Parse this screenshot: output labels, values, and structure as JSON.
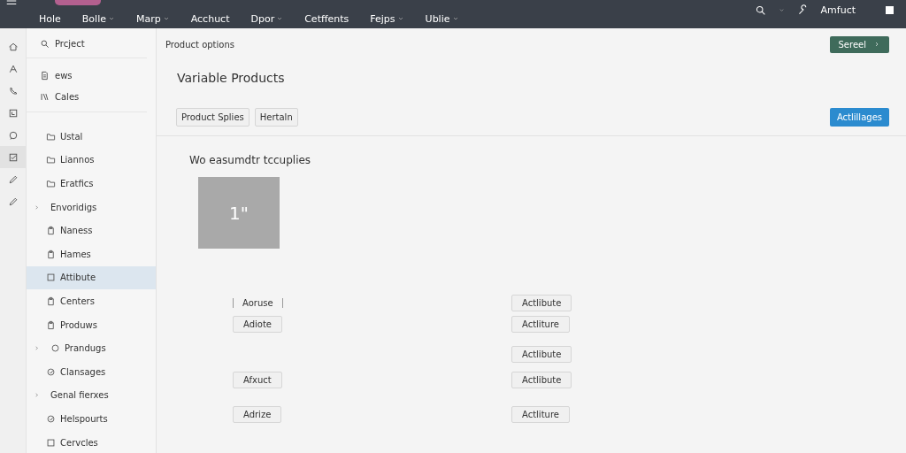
{
  "topbar": {
    "nav": [
      {
        "label": "Hole",
        "dropdown": false
      },
      {
        "label": "Bolle",
        "dropdown": true
      },
      {
        "label": "Marp",
        "dropdown": true
      },
      {
        "label": "Acchuct",
        "dropdown": false
      },
      {
        "label": "Dpor",
        "dropdown": true
      },
      {
        "label": "Cetffents",
        "dropdown": false
      },
      {
        "label": "Fejps",
        "dropdown": true
      },
      {
        "label": "Ublie",
        "dropdown": true
      }
    ],
    "account": "Amfuct"
  },
  "rail": [
    {
      "selected": false
    },
    {
      "selected": false
    },
    {
      "selected": false
    },
    {
      "selected": false
    },
    {
      "selected": false
    },
    {
      "selected": true
    },
    {
      "selected": false
    },
    {
      "selected": false
    }
  ],
  "sidebar": {
    "search": {
      "placeholder": "Prcject"
    },
    "top_items": [
      {
        "label": "ews"
      },
      {
        "label": "Cales"
      }
    ],
    "items": [
      {
        "label": "Ustal",
        "kind": "folder",
        "expander": false,
        "selected": false
      },
      {
        "label": "Liannos",
        "kind": "folder",
        "expander": false,
        "selected": false
      },
      {
        "label": "Eratfics",
        "kind": "folder",
        "expander": false,
        "selected": false
      },
      {
        "label": "Envoridigs",
        "kind": "group",
        "expander": true,
        "selected": false
      },
      {
        "label": "Naness",
        "kind": "page",
        "expander": false,
        "selected": false
      },
      {
        "label": "Hames",
        "kind": "page",
        "expander": false,
        "selected": false
      },
      {
        "label": "Attibute",
        "kind": "box",
        "expander": false,
        "selected": true
      },
      {
        "label": "Centers",
        "kind": "page",
        "expander": false,
        "selected": false
      },
      {
        "label": "Produws",
        "kind": "page",
        "expander": false,
        "selected": false
      },
      {
        "label": "Prandugs",
        "kind": "option",
        "expander": true,
        "selected": false
      },
      {
        "label": "Clansages",
        "kind": "task",
        "expander": false,
        "selected": false
      },
      {
        "label": "Genal fierxes",
        "kind": "group",
        "expander": true,
        "selected": false
      },
      {
        "label": "Helspourts",
        "kind": "task",
        "expander": false,
        "selected": false
      },
      {
        "label": "Cervcles",
        "kind": "box",
        "expander": false,
        "selected": false
      }
    ]
  },
  "main": {
    "breadcrumb": "Product options",
    "primary_button": "Sereel",
    "title": "Variable Products",
    "tabs": [
      {
        "label": "Product Splies"
      },
      {
        "label": "Hertaln"
      }
    ],
    "action_button": "Actlillages",
    "section_title": "Wo easumdtr tccuplies",
    "image_label": "1\"",
    "rows": [
      {
        "left": "Aoruse",
        "kind": "label",
        "right": "Actlibute"
      },
      {
        "left": "Adiote",
        "kind": "button",
        "right": "Actliture"
      },
      {
        "kind": "single",
        "right": "Actlibute"
      },
      {
        "left": "Afxuct",
        "kind": "button",
        "right": "Actlibute"
      },
      {
        "left": "Adrize",
        "kind": "button",
        "right": "Actliture"
      }
    ]
  }
}
